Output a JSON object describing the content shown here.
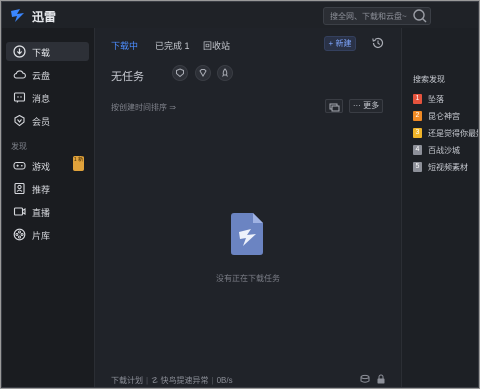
{
  "app": {
    "title": "迅雷"
  },
  "search": {
    "placeholder": "搜全网、下载和云盘~"
  },
  "sidebar": {
    "items": [
      {
        "label": "下载",
        "icon": "download-icon"
      },
      {
        "label": "云盘",
        "icon": "cloud-icon"
      },
      {
        "label": "消息",
        "icon": "message-icon"
      },
      {
        "label": "会员",
        "icon": "vip-icon"
      }
    ],
    "section_label": "发现",
    "discover_items": [
      {
        "label": "游戏",
        "icon": "gamepad-icon"
      },
      {
        "label": "推荐",
        "icon": "recommend-icon"
      },
      {
        "label": "直播",
        "icon": "live-icon"
      },
      {
        "label": "片库",
        "icon": "film-library-icon"
      }
    ],
    "badge": "1 新"
  },
  "tabs": [
    {
      "label": "下载中"
    },
    {
      "label": "已完成 1"
    },
    {
      "label": "回收站"
    }
  ],
  "toolbar": {
    "new_label": "+ 新建"
  },
  "main": {
    "title": "无任务",
    "sort_label": "按创建时间排序 ⇒",
    "more_label": "··· 更多",
    "empty_text": "没有正在下载任务"
  },
  "footer": {
    "plan": "下载计划",
    "speed_status": "快鸟提速异常",
    "speed": "0B/s"
  },
  "right_panel": {
    "title": "搜索发现",
    "items": [
      {
        "rank": "1",
        "label": "坠落",
        "color": "#e5533d"
      },
      {
        "rank": "2",
        "label": "昆仑神宫",
        "color": "#f08a24"
      },
      {
        "rank": "3",
        "label": "还是觉得你最好",
        "color": "#f0b429"
      },
      {
        "rank": "4",
        "label": "百战沙城",
        "color": "#8d9099"
      },
      {
        "rank": "5",
        "label": "短视频素材",
        "color": "#8d9099"
      }
    ]
  },
  "colors": {
    "accent": "#4d8dff",
    "background": "#1f2227",
    "sidebar": "#1a1c20"
  }
}
